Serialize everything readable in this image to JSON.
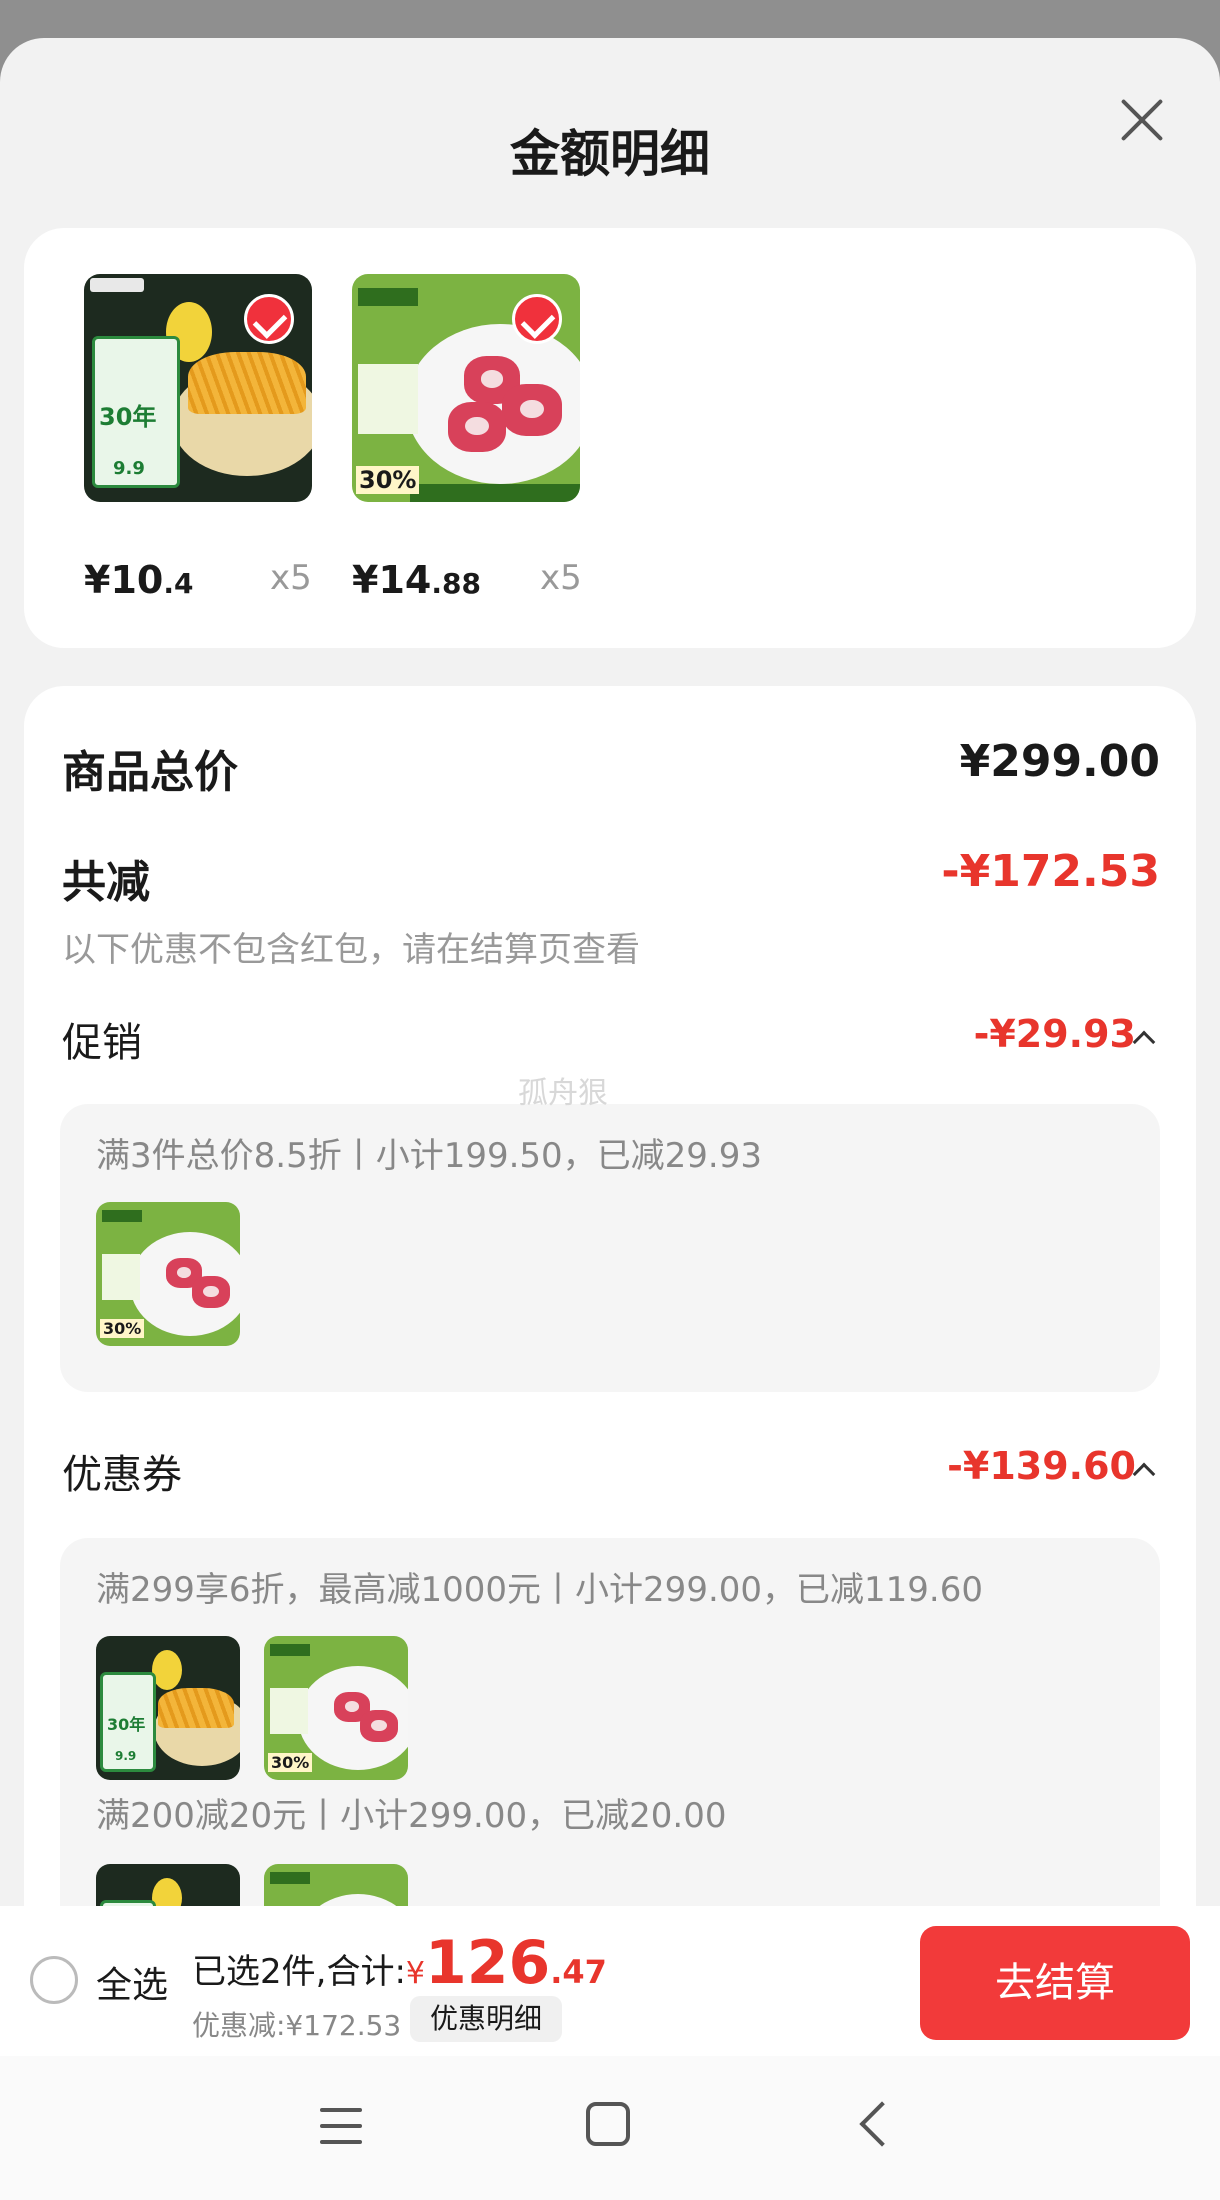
{
  "sheet": {
    "title": "金额明细"
  },
  "products": [
    {
      "price_int": "¥10",
      "price_dec": ".4",
      "qty": "x5",
      "kind": "fries"
    },
    {
      "price_int": "¥14",
      "price_dec": ".88",
      "qty": "x5",
      "kind": "meat"
    }
  ],
  "summary": {
    "total_label": "商品总价",
    "total_value": "¥299.00",
    "reduce_label": "共减",
    "reduce_value": "-¥172.53",
    "note": "以下优惠不包含红包，请在结算页查看"
  },
  "promotion": {
    "label": "促销",
    "amount": "-¥29.93",
    "line": "满3件总价8.5折丨小计199.50，已减29.93"
  },
  "coupon": {
    "label": "优惠券",
    "amount": "-¥139.60",
    "line1": "满299享6折，最高减1000元丨小计299.00，已减119.60",
    "line2": "满200减20元丨小计299.00，已减20.00"
  },
  "watermark": "孤舟狠",
  "bottom_bar": {
    "select_all": "全选",
    "summary_prefix": "已选2件,合计:",
    "currency": "¥",
    "total_int": "126",
    "total_dec": ".47",
    "discount": "优惠减:¥172.53",
    "discount_detail": "优惠明细",
    "checkout": "去结算"
  },
  "colors": {
    "accent": "#e8352c",
    "checkout_bg": "#f23a3a"
  },
  "icons": [
    "close-icon",
    "check-icon",
    "caret-up-icon",
    "radio-icon",
    "menu-icon",
    "home-icon",
    "back-icon"
  ]
}
